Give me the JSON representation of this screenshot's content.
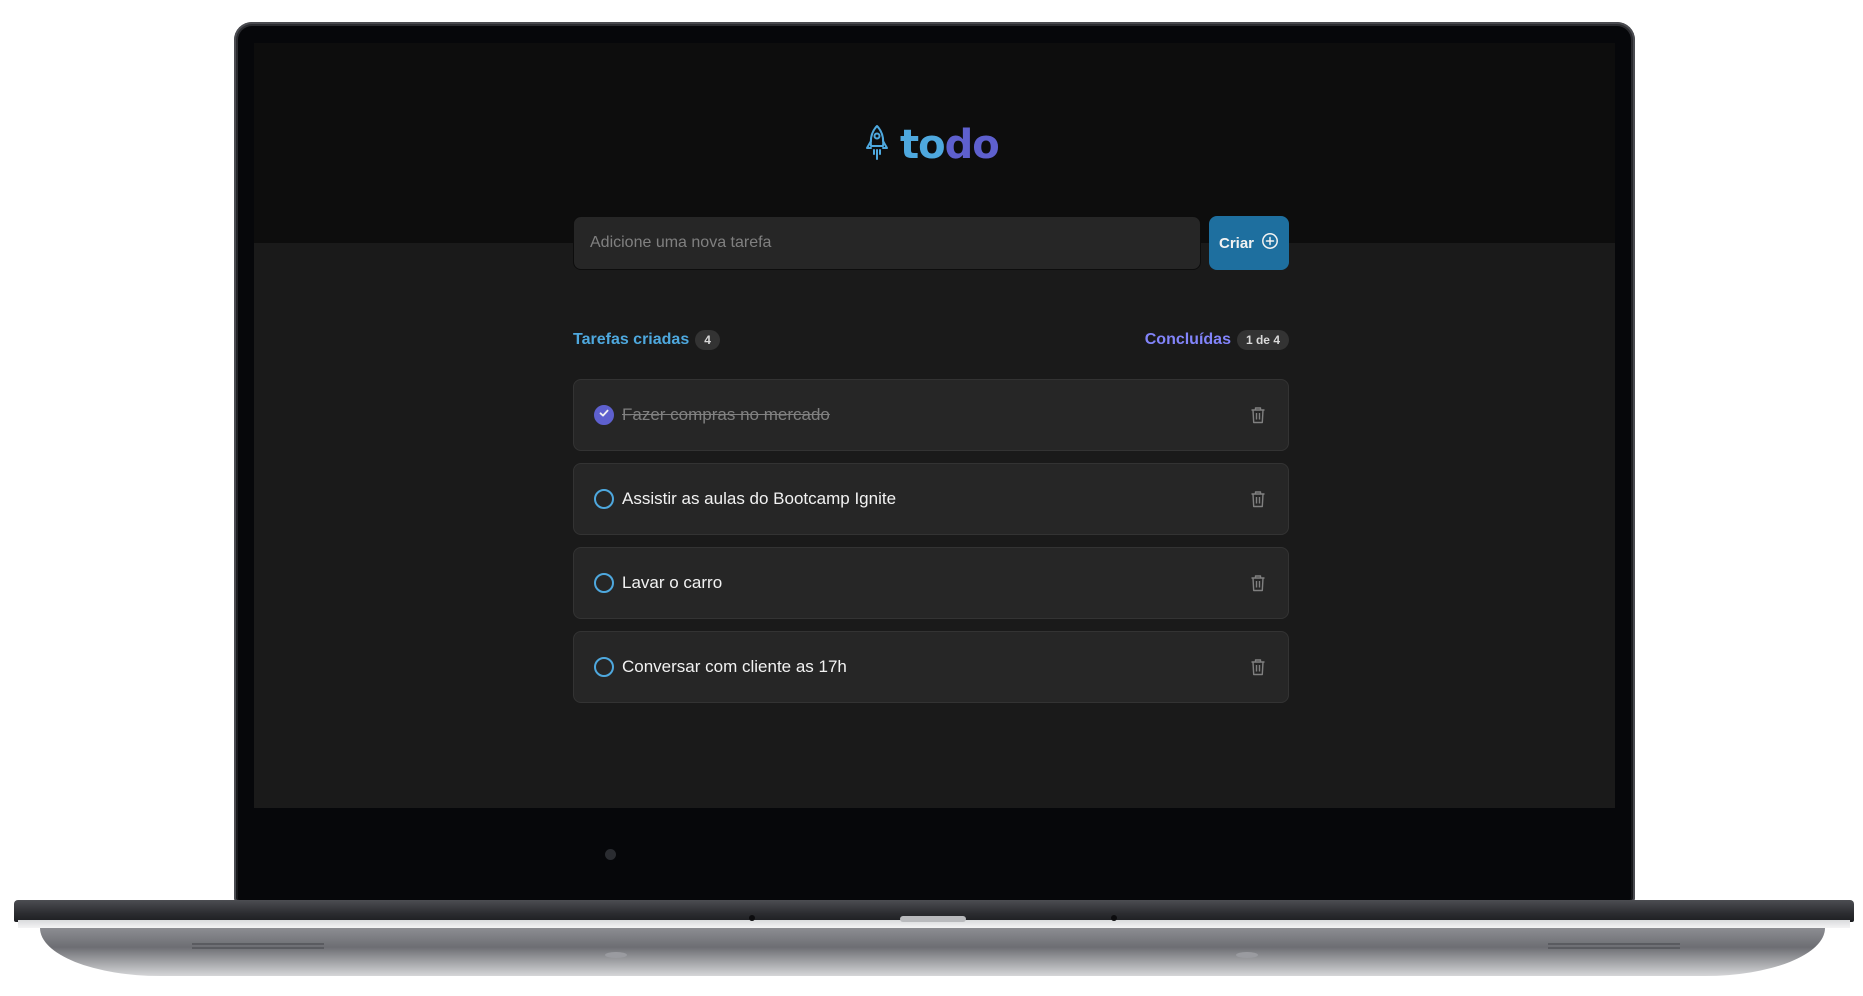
{
  "app": {
    "logo_text_prefix": "t",
    "logo_text_o1": "o",
    "logo_text_d": "d",
    "logo_text_o2": "o",
    "logo_icon": "rocket-icon",
    "colors": {
      "blue": "#4ea8de",
      "purple": "#5e60ce",
      "purple_light": "#8284fa",
      "blue_dark": "#1e6f9f",
      "background": "#1a1a1a",
      "header": "#0d0d0d"
    }
  },
  "form": {
    "placeholder": "Adicione uma nova tarefa",
    "value": "",
    "create_label": "Criar",
    "create_icon": "plus-circle-icon"
  },
  "counters": {
    "created_label": "Tarefas criadas",
    "created_count": "4",
    "done_label": "Concluídas",
    "done_count": "1 de 4"
  },
  "tasks": [
    {
      "text": "Fazer compras no mercado",
      "done": true
    },
    {
      "text": "Assistir as aulas do Bootcamp Ignite",
      "done": false
    },
    {
      "text": "Lavar o carro",
      "done": false
    },
    {
      "text": "Conversar com cliente as 17h",
      "done": false
    }
  ]
}
